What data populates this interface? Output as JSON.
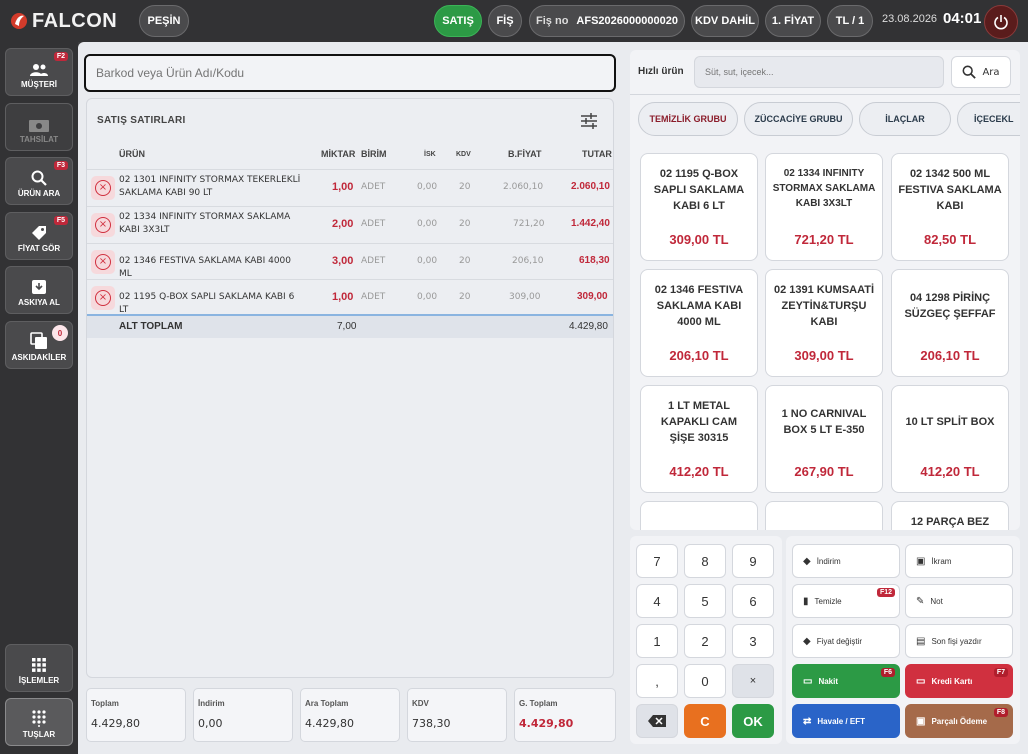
{
  "header": {
    "brand": "FALCON",
    "mode": "PEŞİN",
    "sale_tab": "SATIŞ",
    "receipt_tab": "FİŞ",
    "receipt_no_label": "Fiş no",
    "receipt_no": "AFS2026000000020",
    "vat_mode": "KDV DAHİL",
    "price_level": "1. FİYAT",
    "currency_rate": "TL / 1",
    "date": "23.08.2026",
    "time": "04:01"
  },
  "sidebar": {
    "items": [
      {
        "label": "MÜŞTERİ",
        "key": "F2",
        "icon": "users-icon"
      },
      {
        "label": "TAHSİLAT",
        "key": "",
        "icon": "cash-icon"
      },
      {
        "label": "ÜRÜN ARA",
        "key": "F3",
        "icon": "search-icon"
      },
      {
        "label": "FİYAT GÖR",
        "key": "F5",
        "icon": "tag-icon"
      },
      {
        "label": "ASKIYA AL",
        "key": "",
        "icon": "tray-icon"
      },
      {
        "label": "ASKIDAKİLER",
        "key": "0",
        "icon": "stack-icon"
      },
      {
        "label": "İŞLEMLER",
        "key": "",
        "icon": "grid-icon"
      },
      {
        "label": "TUŞLAR",
        "key": "",
        "icon": "keypad-icon"
      }
    ]
  },
  "search": {
    "placeholder": "Barkod veya Ürün Adı/Kodu"
  },
  "sales": {
    "title": "SATIŞ SATIRLARI",
    "columns": {
      "urun": "ÜRÜN",
      "miktar": "MİKTAR",
      "birim": "BİRİM",
      "isk": "İSK",
      "kdv": "KDV",
      "bfiyat": "B.FİYAT",
      "tutar": "TUTAR"
    },
    "rows": [
      {
        "name": "02 1301 INFINITY STORMAX TEKERLEKLİ SAKLAMA KABI 90 LT",
        "qty": "1,00",
        "unit": "ADET",
        "isk": "0,00",
        "kdv": "20",
        "price": "2.060,10",
        "total": "2.060,10"
      },
      {
        "name": "02 1334 INFINITY STORMAX SAKLAMA KABI 3X3LT",
        "qty": "2,00",
        "unit": "ADET",
        "isk": "0,00",
        "kdv": "20",
        "price": "721,20",
        "total": "1.442,40"
      },
      {
        "name": "02 1346 FESTIVA SAKLAMA KABI 4000 ML",
        "qty": "3,00",
        "unit": "ADET",
        "isk": "0,00",
        "kdv": "20",
        "price": "206,10",
        "total": "618,30"
      },
      {
        "name": "02 1195 Q-BOX SAPLI SAKLAMA KABI 6 LT",
        "qty": "1,00",
        "unit": "ADET",
        "isk": "0,00",
        "kdv": "20",
        "price": "309,00",
        "total": "309,00"
      }
    ],
    "subtotal_label": "ALT TOPLAM",
    "subtotal_qty": "7,00",
    "subtotal_total": "4.429,80"
  },
  "summary": [
    {
      "label": "Toplam",
      "value": "4.429,80"
    },
    {
      "label": "İndirim",
      "value": "0,00"
    },
    {
      "label": "Ara Toplam",
      "value": "4.429,80"
    },
    {
      "label": "KDV",
      "value": "738,30"
    },
    {
      "label": "G. Toplam",
      "value": "4.429,80"
    }
  ],
  "quick": {
    "label": "Hızlı ürün",
    "placeholder": "Süt, sut, içecek...",
    "search_label": "Ara",
    "categories": [
      "TEMİZLİK GRUBU",
      "ZÜCCACİYE GRUBU",
      "İLAÇLAR",
      "İÇECEKL"
    ],
    "products": [
      {
        "name": "02 1195 Q-BOX SAPLI SAKLAMA KABI 6 LT",
        "price": "309,00 TL"
      },
      {
        "name": "02 1334 INFINITY STORMAX SAKLAMA KABI 3X3LT",
        "price": "721,20 TL"
      },
      {
        "name": "02 1342 500 ML FESTIVA SAKLAMA KABI",
        "price": "82,50 TL"
      },
      {
        "name": "02 1346 FESTIVA SAKLAMA KABI 4000 ML",
        "price": "206,10 TL"
      },
      {
        "name": "02 1391 KUMSAATİ ZEYTİN&TURŞU KABI",
        "price": "309,00 TL"
      },
      {
        "name": "04 1298 PİRİNÇ SÜZGEÇ ŞEFFAF",
        "price": "206,10 TL"
      },
      {
        "name": "1 LT METAL KAPAKLI CAM ŞİŞE 30315",
        "price": "412,20 TL"
      },
      {
        "name": "1 NO CARNIVAL BOX 5 LT E-350",
        "price": "267,90 TL"
      },
      {
        "name": "10 LT SPLİT BOX",
        "price": "412,20 TL"
      },
      {
        "name": "",
        "price": ""
      },
      {
        "name": "",
        "price": ""
      },
      {
        "name": "12 PARÇA BEZ",
        "price": ""
      }
    ]
  },
  "keypad": {
    "keys": [
      "7",
      "8",
      "9",
      "4",
      "5",
      "6",
      "1",
      "2",
      "3",
      ",",
      "0",
      "×"
    ],
    "clear": "C",
    "ok": "OK"
  },
  "actions": {
    "indirim": "İndirim",
    "ikram": "İkram",
    "temizle": "Temizle",
    "temizle_key": "F12",
    "not": "Not",
    "fiyat_degistir": "Fiyat değiştir",
    "son_fis": "Son fişi yazdır",
    "nakit": "Nakit",
    "nakit_key": "F6",
    "kredi": "Kredi Kartı",
    "kredi_key": "F7",
    "havale": "Havale / EFT",
    "parcali": "Parçalı Ödeme",
    "parcali_key": "F8"
  }
}
